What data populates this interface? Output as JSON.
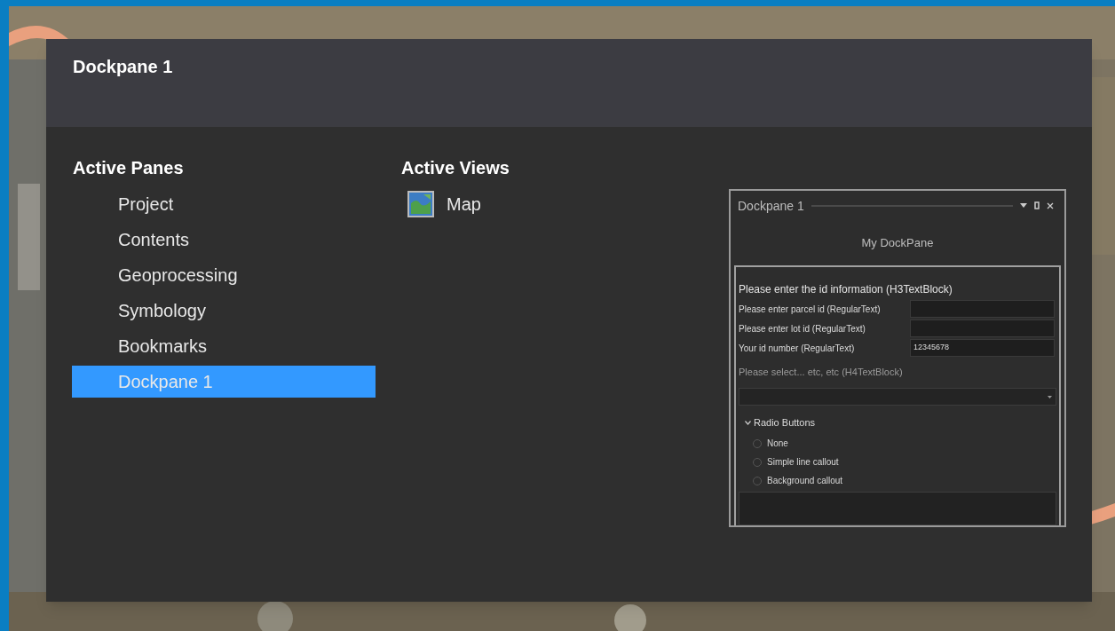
{
  "dialog": {
    "title": "Dockpane 1"
  },
  "active_panes": {
    "heading": "Active Panes",
    "items": [
      {
        "label": "Project",
        "selected": false
      },
      {
        "label": "Contents",
        "selected": false
      },
      {
        "label": "Geoprocessing",
        "selected": false
      },
      {
        "label": "Symbology",
        "selected": false
      },
      {
        "label": "Bookmarks",
        "selected": false
      },
      {
        "label": "Dockpane 1",
        "selected": true
      }
    ]
  },
  "active_views": {
    "heading": "Active Views",
    "items": [
      {
        "label": "Map"
      }
    ]
  },
  "preview": {
    "title": "Dockpane 1",
    "heading": "My DockPane",
    "section_title": "Please enter the id information (H3TextBlock)",
    "fields": [
      {
        "label": "Please enter parcel id (RegularText)"
      },
      {
        "label": "Please enter lot id (RegularText)"
      },
      {
        "label": "Your id number (RegularText)",
        "value": "12345678"
      }
    ],
    "hint": "Please select... etc, etc (H4TextBlock)",
    "group": {
      "label": "Radio Buttons",
      "expanded": true,
      "options": [
        {
          "label": "None",
          "selected": false
        },
        {
          "label": "Simple line callout",
          "selected": false
        },
        {
          "label": "Background callout",
          "selected": false
        }
      ]
    }
  }
}
